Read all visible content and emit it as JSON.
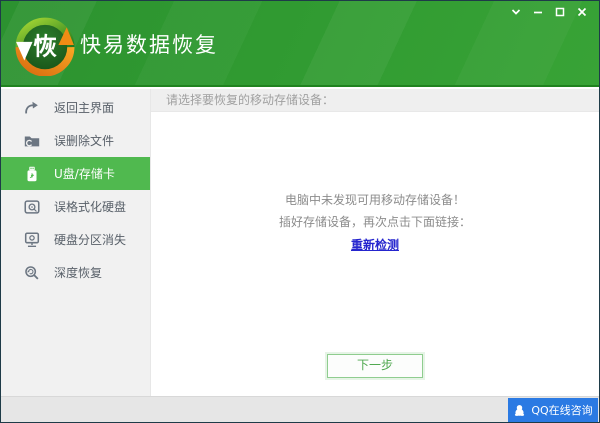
{
  "header": {
    "app_title": "快易数据恢复",
    "logo_char": "恢",
    "window_controls": [
      {
        "icon": "chevron-down-icon"
      },
      {
        "icon": "minimize-icon"
      },
      {
        "icon": "maximize-icon"
      },
      {
        "icon": "close-icon"
      }
    ]
  },
  "sidebar": {
    "items": [
      {
        "label": "返回主界面",
        "icon": "return-arrow-icon",
        "selected": false
      },
      {
        "label": "误删除文件",
        "icon": "folder-icon",
        "selected": false
      },
      {
        "label": "U盘/存储卡",
        "icon": "usb-drive-icon",
        "selected": true
      },
      {
        "label": "误格式化硬盘",
        "icon": "hard-disk-icon",
        "selected": false
      },
      {
        "label": "硬盘分区消失",
        "icon": "disk-partition-icon",
        "selected": false
      },
      {
        "label": "深度恢复",
        "icon": "deep-scan-icon",
        "selected": false
      }
    ]
  },
  "content": {
    "strip_title": "请选择要恢复的移动存储设备：",
    "message_line1": "电脑中未发现可用移动存储设备！",
    "message_line2": "插好存储设备，再次点击下面链接：",
    "retry_link": "重新检测",
    "next_button": "下一步"
  },
  "footer": {
    "qq_button": "QQ在线咨询",
    "qq_icon": "qq-penguin-icon"
  },
  "colors": {
    "header_green": "#2f9b31",
    "selected_item_green": "#50b94f",
    "link_blue": "#2525ce",
    "qq_button_blue": "#2b7ae3",
    "next_button_green": "#4fa84f",
    "sidebar_gray": "#f1f1f1",
    "footer_gray": "#e6e6e6"
  }
}
